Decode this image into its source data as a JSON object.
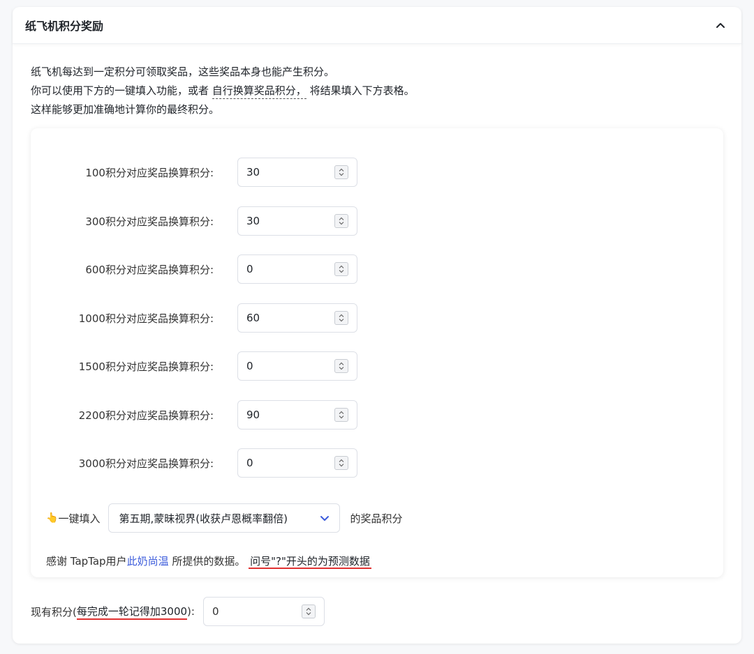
{
  "panel": {
    "title": "纸飞机积分奖励"
  },
  "intro": {
    "line1": "纸飞机每达到一定积分可领取奖品，这些奖品本身也能产生积分。",
    "line2_prefix": "你可以使用下方的一键填入功能，或者 ",
    "line2_link": "自行换算奖品积分，",
    "line2_suffix": " 将结果填入下方表格。",
    "line3": "这样能够更加准确地计算你的最终积分。"
  },
  "rewards": [
    {
      "label": "100积分对应奖品换算积分:",
      "value": "30"
    },
    {
      "label": "300积分对应奖品换算积分:",
      "value": "30"
    },
    {
      "label": "600积分对应奖品换算积分:",
      "value": "0"
    },
    {
      "label": "1000积分对应奖品换算积分:",
      "value": "60"
    },
    {
      "label": "1500积分对应奖品换算积分:",
      "value": "0"
    },
    {
      "label": "2200积分对应奖品换算积分:",
      "value": "90"
    },
    {
      "label": "3000积分对应奖品换算积分:",
      "value": "0"
    }
  ],
  "quick_fill": {
    "icon": "👆",
    "label": "一键填入",
    "selected": "第五期,蒙昧视界(收获卢恩概率翻倍)",
    "suffix": "的奖品积分"
  },
  "thanks": {
    "prefix": "感谢 TapTap用户",
    "user": "此奶尚温",
    "middle": " 所提供的数据。",
    "note": "问号\"?\"开头的为预测数据"
  },
  "current": {
    "label_prefix": "现有积分(",
    "label_hint": "每完成一轮记得加3000",
    "label_suffix": "):",
    "value": "0"
  },
  "colors": {
    "link": "#3b5bdb",
    "underline_red": "#e03131",
    "select_chevron": "#3b5bdb"
  }
}
